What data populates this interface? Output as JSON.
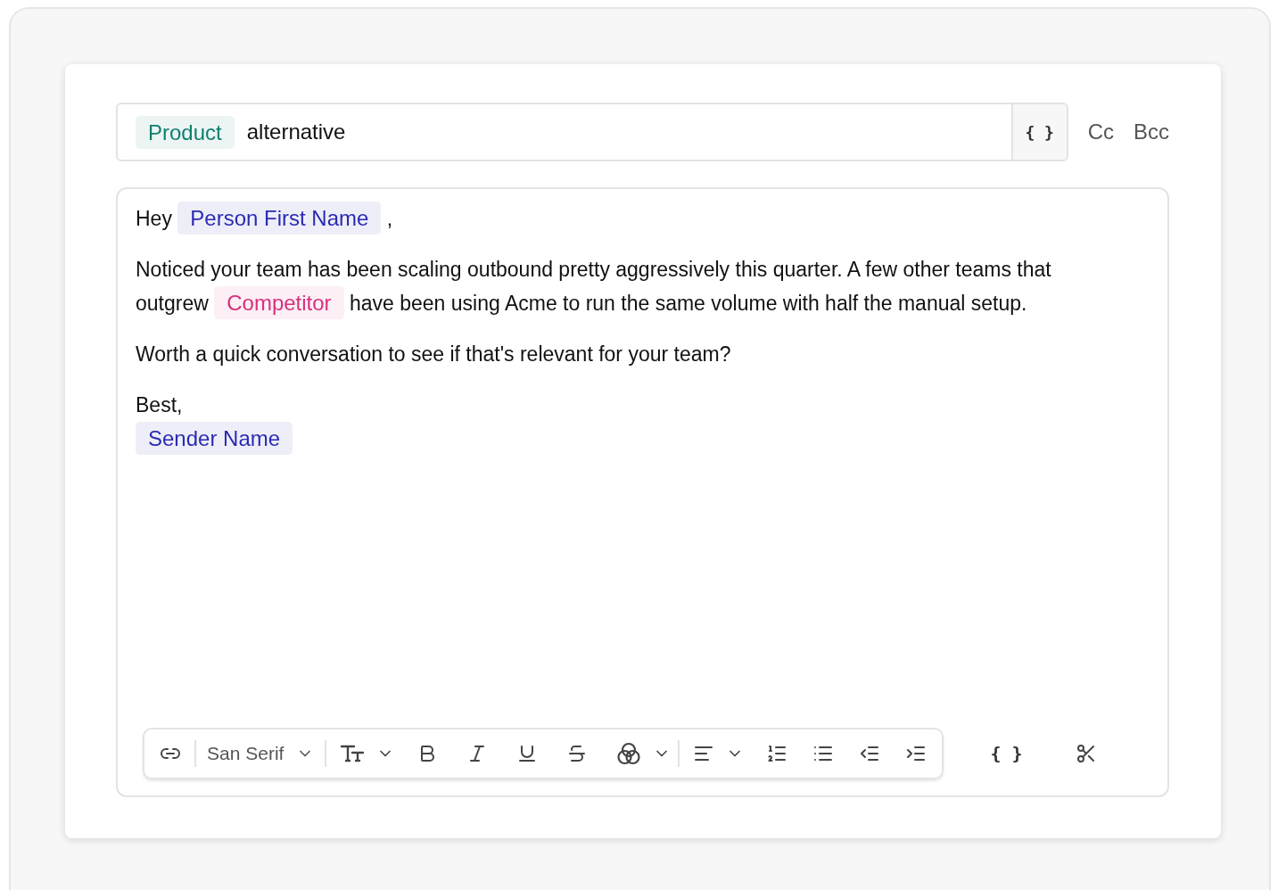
{
  "subject": {
    "tag": {
      "text": "Product",
      "color": "#0f7f6e"
    },
    "value": "alternative",
    "variable_button": "{ }"
  },
  "recipients": [
    "Cc",
    "Bcc"
  ],
  "body": {
    "paragraphs": [
      [
        {
          "kind": "text",
          "text": "Hey"
        },
        {
          "kind": "tag",
          "text": "Person First Name",
          "color": "#2b2bb3"
        },
        {
          "kind": "text",
          "text": ","
        }
      ],
      [
        {
          "kind": "text",
          "text": "Noticed your team has been scaling outbound pretty aggressively this quarter. A few other teams that outgrew"
        },
        {
          "kind": "tag",
          "text": "Competitor",
          "color": "#d6317e"
        },
        {
          "kind": "text",
          "text": "have been using Acme to run the same volume with half the manual setup."
        }
      ],
      [
        {
          "kind": "text",
          "text": "Worth a quick conversation to see if that's relevant for your team?"
        }
      ],
      [
        {
          "kind": "text",
          "text": "Best,"
        },
        {
          "kind": "break"
        },
        {
          "kind": "tag",
          "text": "Sender Name",
          "color": "#2b2bb3"
        }
      ]
    ]
  },
  "toolbar": {
    "font": "San Serif",
    "variable_button": "{ }"
  }
}
